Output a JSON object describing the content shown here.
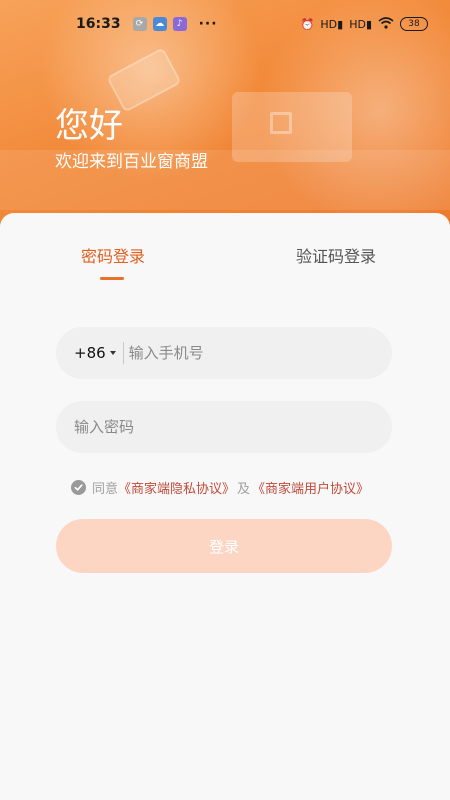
{
  "status_bar": {
    "time": "16:33",
    "dots": "···",
    "signal_1": "HD",
    "signal_2": "HD",
    "battery": "38"
  },
  "hero": {
    "greeting": "您好",
    "welcome": "欢迎来到百业窗商盟"
  },
  "tabs": {
    "password_login": "密码登录",
    "code_login": "验证码登录",
    "active_color": "#e0601e"
  },
  "form": {
    "country_code": "+86",
    "phone_placeholder": "输入手机号",
    "password_placeholder": "输入密码"
  },
  "agreement": {
    "agree": "同意",
    "privacy": "《商家端隐私协议》",
    "and": "及",
    "user": "《商家端用户协议》"
  },
  "login_button": {
    "label": "登录",
    "color": "#fcd6c3"
  }
}
